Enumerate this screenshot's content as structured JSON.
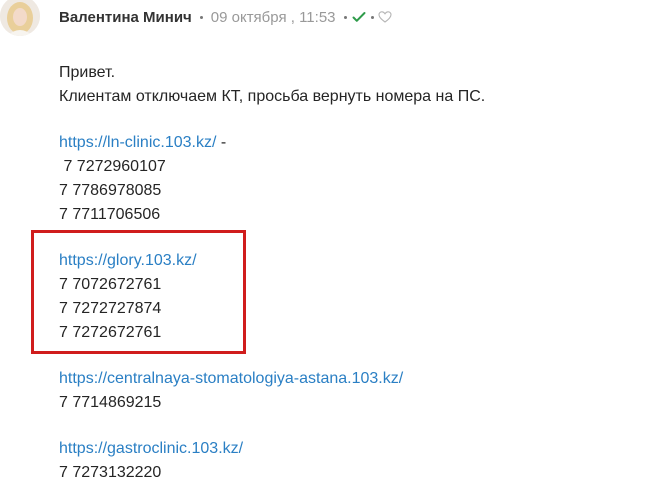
{
  "message": {
    "author": "Валентина Минич",
    "timestamp": "09 октября , 11:53",
    "colors": {
      "link": "#2a7fc4",
      "check": "#2e9b4a",
      "highlight_border": "#d01c1c"
    },
    "icons": {
      "status": "double-check-icon",
      "reaction": "heart-outline-icon"
    },
    "greeting": "Привет.",
    "request": "Клиентам отключаем КТ, просьба вернуть номера на ПС.",
    "blocks": [
      {
        "url": "https://ln-clinic.103.kz/",
        "suffix": " -",
        "numbers": [
          " 7 7272960107",
          "7 7786978085",
          "7 7711706506"
        ]
      },
      {
        "url": "https://glory.103.kz/",
        "suffix": "",
        "numbers": [
          "7 7072672761",
          "7 7272727874",
          "7 7272672761"
        ]
      },
      {
        "url": "https://centralnaya-stomatologiya-astana.103.kz/",
        "suffix": "",
        "numbers": [
          "7 7714869215"
        ]
      },
      {
        "url": "https://gastroclinic.103.kz/",
        "suffix": "",
        "numbers": [
          "7 7273132220"
        ]
      }
    ]
  }
}
